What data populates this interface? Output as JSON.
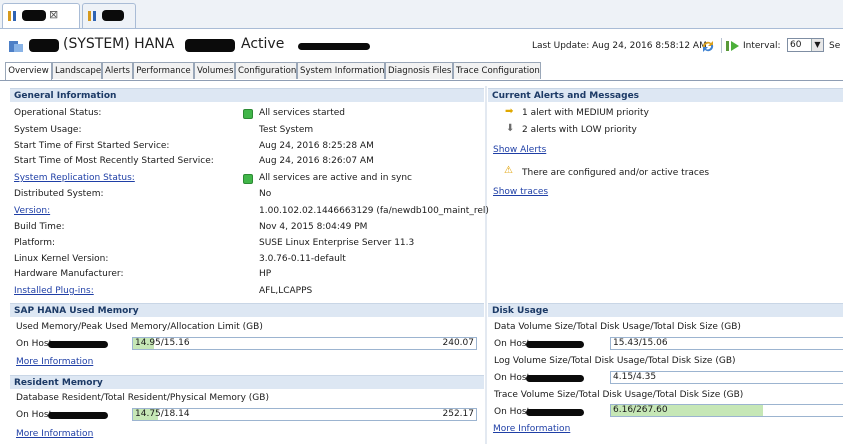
{
  "editor_tabs": {
    "close_symbol": "⊠"
  },
  "header": {
    "system_title": "(SYSTEM) HANA",
    "status_word": "Active",
    "last_update_label": "Last Update:",
    "last_update_value": "Aug 24, 2016 8:58:12 AM",
    "interval_label": "Interval:",
    "interval_value": "60",
    "cut_off": "Se"
  },
  "tabs": [
    {
      "label": "Overview",
      "active": true
    },
    {
      "label": "Landscape",
      "active": false
    },
    {
      "label": "Alerts",
      "active": false
    },
    {
      "label": "Performance",
      "active": false
    },
    {
      "label": "Volumes",
      "active": false
    },
    {
      "label": "Configuration",
      "active": false
    },
    {
      "label": "System Information",
      "active": false
    },
    {
      "label": "Diagnosis Files",
      "active": false
    },
    {
      "label": "Trace Configuration",
      "active": false
    }
  ],
  "general": {
    "title": "General Information",
    "rows": [
      {
        "label": "Operational Status:",
        "value": "All services started"
      },
      {
        "label": "System Usage:",
        "value": "Test System"
      },
      {
        "label": "Start Time of First Started Service:",
        "value": "Aug 24, 2016 8:25:28 AM"
      },
      {
        "label": "Start Time of Most Recently Started Service:",
        "value": "Aug 24, 2016 8:26:07 AM"
      },
      {
        "label": "System Replication Status:",
        "value": "All services are active and in sync"
      },
      {
        "label": "Distributed System:",
        "value": "No"
      },
      {
        "label": "Version:",
        "value": "1.00.102.02.1446663129 (fa/newdb100_maint_rel)"
      },
      {
        "label": "Build Time:",
        "value": "Nov 4, 2015 8:04:49 PM"
      },
      {
        "label": "Platform:",
        "value": "SUSE Linux Enterprise Server 11.3"
      },
      {
        "label": "Linux Kernel Version:",
        "value": "3.0.76-0.11-default"
      },
      {
        "label": "Hardware Manufacturer:",
        "value": "HP"
      },
      {
        "label": "Installed Plug-ins:",
        "value": "AFL,LCAPPS"
      }
    ]
  },
  "alerts": {
    "title": "Current Alerts and Messages",
    "medium": "1 alert with MEDIUM priority",
    "low": "2 alerts with LOW priority",
    "show_alerts": "Show Alerts",
    "trace_msg": "There are configured and/or active traces",
    "show_traces": "Show traces"
  },
  "hana_memory": {
    "title": "SAP HANA Used Memory",
    "caption": "Used Memory/Peak Used Memory/Allocation Limit (GB)",
    "host_label": "On Host",
    "bar_text": "14.95/15.16",
    "bar_right": "240.07",
    "fill": 0.0623,
    "more": "More Information"
  },
  "resident_memory": {
    "title": "Resident Memory",
    "caption": "Database Resident/Total Resident/Physical Memory (GB)",
    "host_label": "On Host",
    "bar_text": "14.75/18.14",
    "bar_right": "252.17",
    "fill": 0.072,
    "more": "More Information"
  },
  "disk": {
    "title": "Disk Usage",
    "data_caption": "Data Volume Size/Total Disk Usage/Total Disk Size (GB)",
    "data_bar": "15.43/15.06",
    "log_caption": "Log Volume Size/Total Disk Usage/Total Disk Size (GB)",
    "log_bar": "4.15/4.35",
    "trace_caption": "Trace Volume Size/Total Disk Usage/Total Disk Size (GB)",
    "trace_bar": "6.16/267.60",
    "trace_fill": 0.64,
    "host_label": "On Host",
    "more": "More Information"
  }
}
